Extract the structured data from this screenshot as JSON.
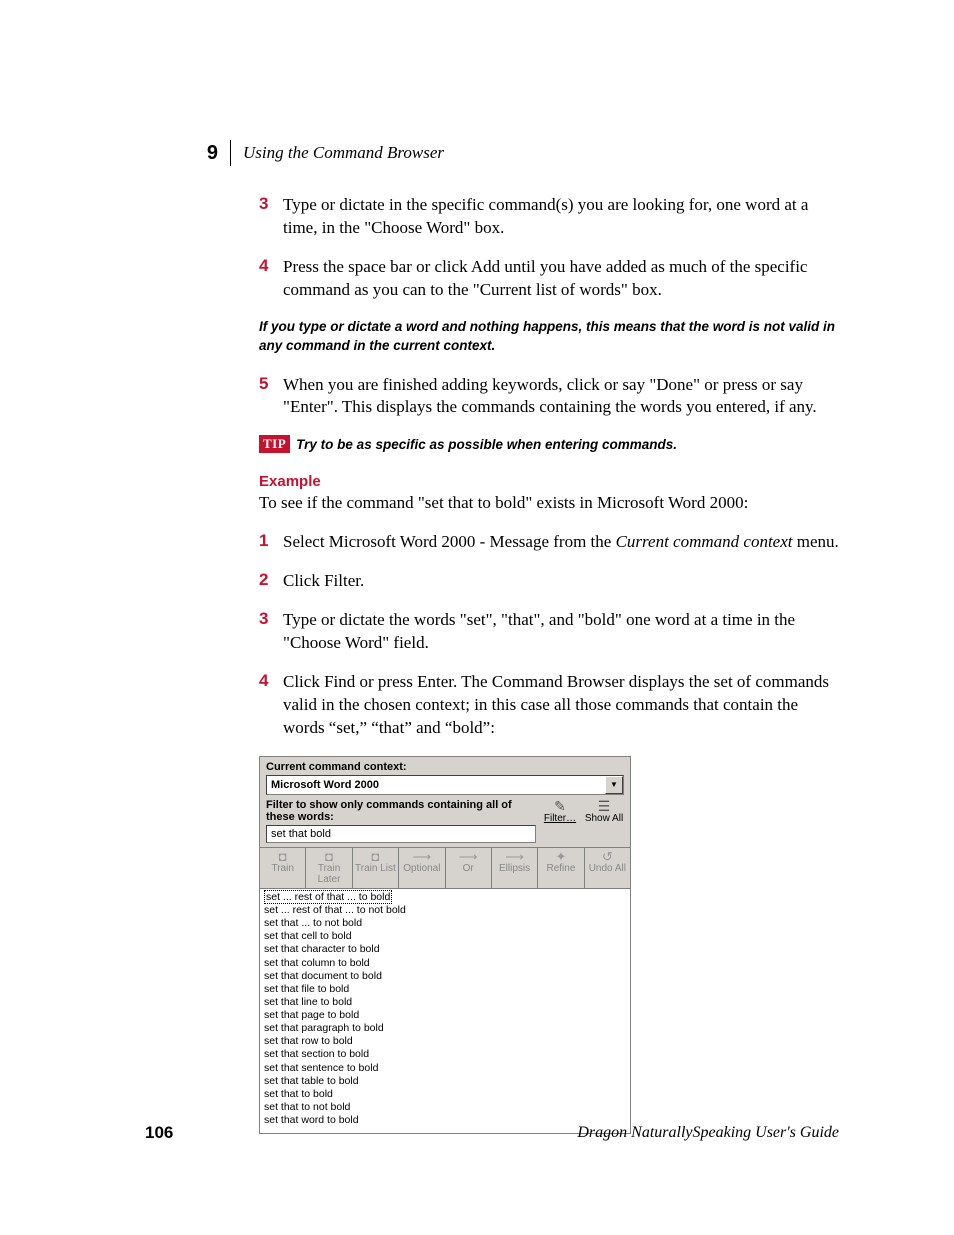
{
  "header": {
    "chapter_number": "9",
    "chapter_title": "Using the Command Browser"
  },
  "steps_a": [
    {
      "n": "3",
      "text": "Type or dictate in the specific command(s) you are looking for, one word at a time, in the \"Choose Word\" box."
    },
    {
      "n": "4",
      "text": "Press the space bar or click Add until you have added as much of the specific command as you can to the \"Current list of words\" box."
    }
  ],
  "note1": "If you type or dictate a word and nothing happens, this means that the word is not valid in any command in the current context.",
  "steps_b": [
    {
      "n": "5",
      "text": "When you are finished adding keywords, click or say \"Done\" or press or say \"Enter\". This displays the commands containing the words you entered, if any."
    }
  ],
  "tip": {
    "badge": "TIP",
    "text": "Try to be as specific as possible when entering commands."
  },
  "example": {
    "heading": "Example",
    "intro": "To see if the command \"set that to bold\" exists in Microsoft Word 2000:",
    "steps": [
      {
        "n": "1",
        "pre": "Select Microsoft Word 2000 - Message from the ",
        "ital": "Current command context",
        "post": " menu."
      },
      {
        "n": "2",
        "pre": "Click Filter.",
        "ital": "",
        "post": ""
      },
      {
        "n": "3",
        "pre": "Type or dictate the words \"set\", \"that\", and \"bold\" one word at a time in the \"Choose Word\" field.",
        "ital": "",
        "post": ""
      },
      {
        "n": "4",
        "pre": "Click Find or press Enter. The Command Browser displays the set of commands valid in the chosen context; in this case all those commands that contain the words “set,” “that” and “bold”:",
        "ital": "",
        "post": ""
      }
    ]
  },
  "app": {
    "context_label": "Current command context:",
    "context_value": "Microsoft Word 2000",
    "filter_label": "Filter to show only commands containing all of these words:",
    "filter_value": "set that bold",
    "side_buttons": {
      "filter": "Filter…",
      "show_all": "Show All"
    },
    "toolbar": [
      "Train",
      "Train Later",
      "Train List",
      "Optional",
      "Or",
      "Ellipsis",
      "Refine",
      "Undo All"
    ],
    "results": [
      "set ... rest of that ... to bold",
      "set ... rest of that ... to not bold",
      "set that ... to not bold",
      "set that cell to bold",
      "set that character to bold",
      "set that column to bold",
      "set that document to bold",
      "set that file to bold",
      "set that line to bold",
      "set that page to bold",
      "set that paragraph to bold",
      "set that row to bold",
      "set that section to bold",
      "set that sentence to bold",
      "set that table to bold",
      "set that to bold",
      "set that to not bold",
      "set that word to bold"
    ]
  },
  "footer": {
    "page": "106",
    "title": "Dragon NaturallySpeaking User's Guide"
  }
}
